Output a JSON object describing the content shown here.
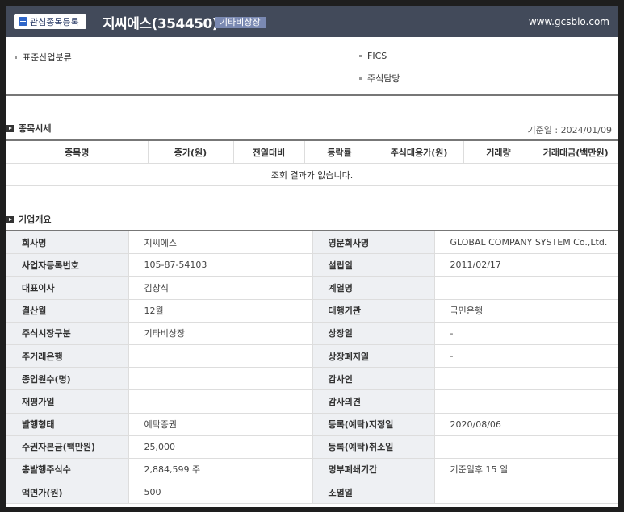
{
  "header": {
    "fav_label": "관심종목등록",
    "company_title": "지씨에스(354450)",
    "market_badge": "기타비상장",
    "website": "www.gcsbio.com"
  },
  "info": {
    "industry_label": "표준산업분류",
    "fics_label": "FICS",
    "stock_manager_label": "주식담당"
  },
  "price_section": {
    "title": "종목시세",
    "as_of": "기준일 : 2024/01/09",
    "columns": [
      "종목명",
      "종가(원)",
      "전일대비",
      "등락률",
      "주식대용가(원)",
      "거래량",
      "거래대금(백만원)"
    ],
    "empty_message": "조회 결과가 없습니다."
  },
  "overview_section": {
    "title": "기업개요",
    "rows": [
      {
        "l1": "회사명",
        "v1": "지씨에스",
        "l2": "영문회사명",
        "v2": "GLOBAL COMPANY SYSTEM Co.,Ltd."
      },
      {
        "l1": "사업자등록번호",
        "v1": "105-87-54103",
        "l2": "설립일",
        "v2": "2011/02/17"
      },
      {
        "l1": "대표이사",
        "v1": "김창식",
        "l2": "계열명",
        "v2": ""
      },
      {
        "l1": "결산월",
        "v1": "12월",
        "l2": "대행기관",
        "v2": "국민은행"
      },
      {
        "l1": "주식시장구분",
        "v1": "기타비상장",
        "l2": "상장일",
        "v2": "-"
      },
      {
        "l1": "주거래은행",
        "v1": "",
        "l2": "상장폐지일",
        "v2": "-"
      },
      {
        "l1": "종업원수(명)",
        "v1": "",
        "l2": "감사인",
        "v2": ""
      },
      {
        "l1": "재평가일",
        "v1": "",
        "l2": "감사의견",
        "v2": ""
      },
      {
        "l1": "발행형태",
        "v1": "예탁증권",
        "l2": "등록(예탁)지정일",
        "v2": "2020/08/06"
      },
      {
        "l1": "수권자본금(백만원)",
        "v1": "25,000",
        "l2": "등록(예탁)취소일",
        "v2": ""
      },
      {
        "l1": "총발행주식수",
        "v1": "2,884,599 주",
        "l2": "명부폐쇄기간",
        "v2": "기준일후 15 일"
      },
      {
        "l1": "액면가(원)",
        "v1": "500",
        "l2": "소멸일",
        "v2": ""
      }
    ]
  }
}
